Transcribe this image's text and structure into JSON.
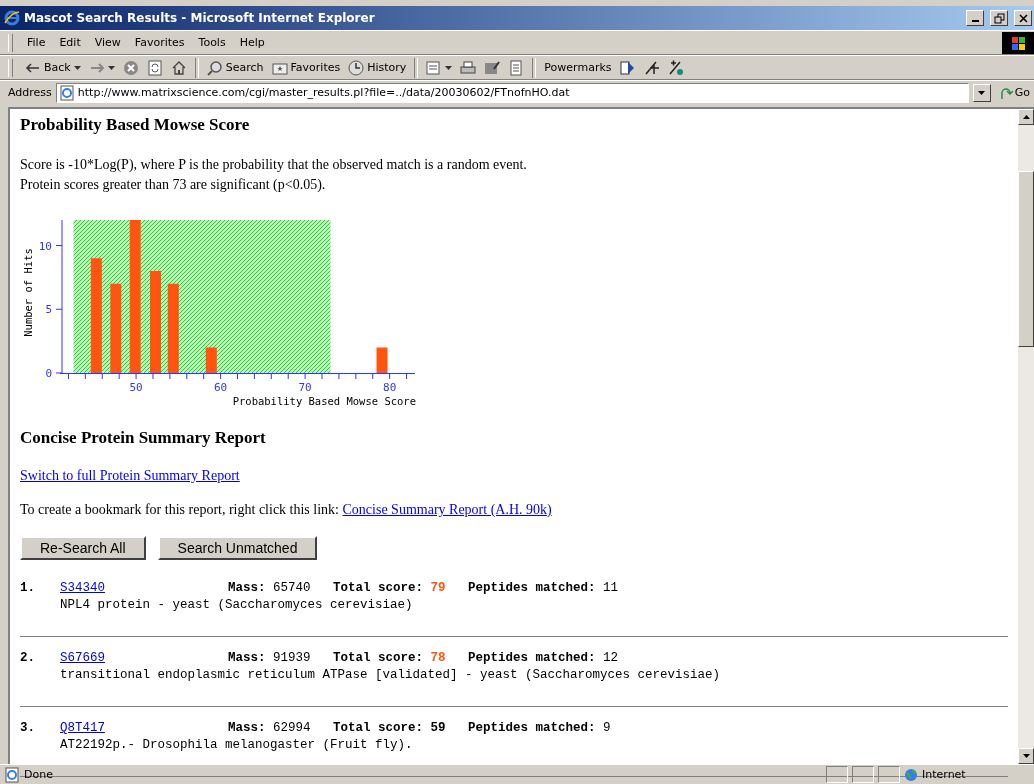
{
  "window": {
    "title": "Mascot Search Results - Microsoft Internet Explorer"
  },
  "menu": [
    {
      "label": "File"
    },
    {
      "label": "Edit"
    },
    {
      "label": "View"
    },
    {
      "label": "Favorites"
    },
    {
      "label": "Tools"
    },
    {
      "label": "Help"
    }
  ],
  "toolbar": [
    {
      "kind": "back",
      "label": "Back",
      "dropdown": true
    },
    {
      "kind": "forward",
      "dropdown": true
    },
    {
      "kind": "stop"
    },
    {
      "kind": "refresh"
    },
    {
      "kind": "home"
    },
    {
      "kind": "sep"
    },
    {
      "kind": "search",
      "label": "Search"
    },
    {
      "kind": "favorites",
      "label": "Favorites"
    },
    {
      "kind": "history",
      "label": "History"
    },
    {
      "kind": "sep"
    },
    {
      "kind": "mail",
      "dropdown": true
    },
    {
      "kind": "print"
    },
    {
      "kind": "edit"
    },
    {
      "kind": "discuss"
    },
    {
      "kind": "sep"
    },
    {
      "kind": "text",
      "label": "Powermarks"
    },
    {
      "kind": "pm1"
    },
    {
      "kind": "pm2"
    },
    {
      "kind": "pm3"
    }
  ],
  "address": {
    "label": "Address",
    "value": "http://www.matrixscience.com/cgi/master_results.pl?file=../data/20030602/FTnofnHO.dat",
    "go": "Go"
  },
  "page": {
    "heading": "Probability Based Mowse Score",
    "intro": [
      "Score is -10*Log(P), where P is the probability that the observed match is a random event.",
      "Protein scores greater than 73 are significant (p<0.05)."
    ],
    "chart_data": {
      "type": "bar",
      "xlabel": "Probability Based Mowse Score",
      "ylabel": "Number of Hits",
      "x": [
        45.3,
        47.6,
        49.9,
        52.3,
        54.4,
        58.9,
        79.1
      ],
      "series": [
        {
          "color": "#ff5511",
          "values": [
            9,
            7,
            12,
            8,
            7,
            2,
            2
          ]
        }
      ],
      "xlim": [
        41,
        83
      ],
      "ylim": [
        0,
        12
      ],
      "xticks": [
        50,
        60,
        70,
        80
      ],
      "yticks": [
        0,
        5,
        10
      ],
      "bands": [
        {
          "axis": "x",
          "from": 42.6,
          "to": 73
        }
      ]
    },
    "summary_heading": "Concise Protein Summary Report",
    "switch_link": "Switch to full Protein Summary Report",
    "bookmark": {
      "text": "To create a bookmark for this report, right click this link:",
      "link": "Concise Summary Report (A.H. 90k)"
    },
    "buttons": [
      "Re-Search All",
      "Search Unmatched"
    ],
    "results": [
      {
        "rank": "1.",
        "accession": "S34340",
        "mass_label": "Mass:",
        "mass": "65740",
        "score_label": "Total score:",
        "score": "79",
        "significant": true,
        "peptides_label": "Peptides matched:",
        "peptides": "11",
        "description": "NPL4 protein - yeast (Saccharomyces cerevisiae)"
      },
      {
        "rank": "2.",
        "accession": "S67669",
        "mass_label": "Mass:",
        "mass": "91939",
        "score_label": "Total score:",
        "score": "78",
        "significant": true,
        "peptides_label": "Peptides matched:",
        "peptides": "12",
        "description": "transitional endoplasmic reticulum ATPase [validated] - yeast (Saccharomyces cerevisiae)"
      },
      {
        "rank": "3.",
        "accession": "Q8T417",
        "mass_label": "Mass:",
        "mass": "62994",
        "score_label": "Total score:",
        "score": "59",
        "significant": false,
        "peptides_label": "Peptides matched:",
        "peptides": "9",
        "description": "AT22192p.- Drosophila melanogaster (Fruit fly)."
      }
    ]
  },
  "status": {
    "text": "Done",
    "zone": "Internet"
  }
}
